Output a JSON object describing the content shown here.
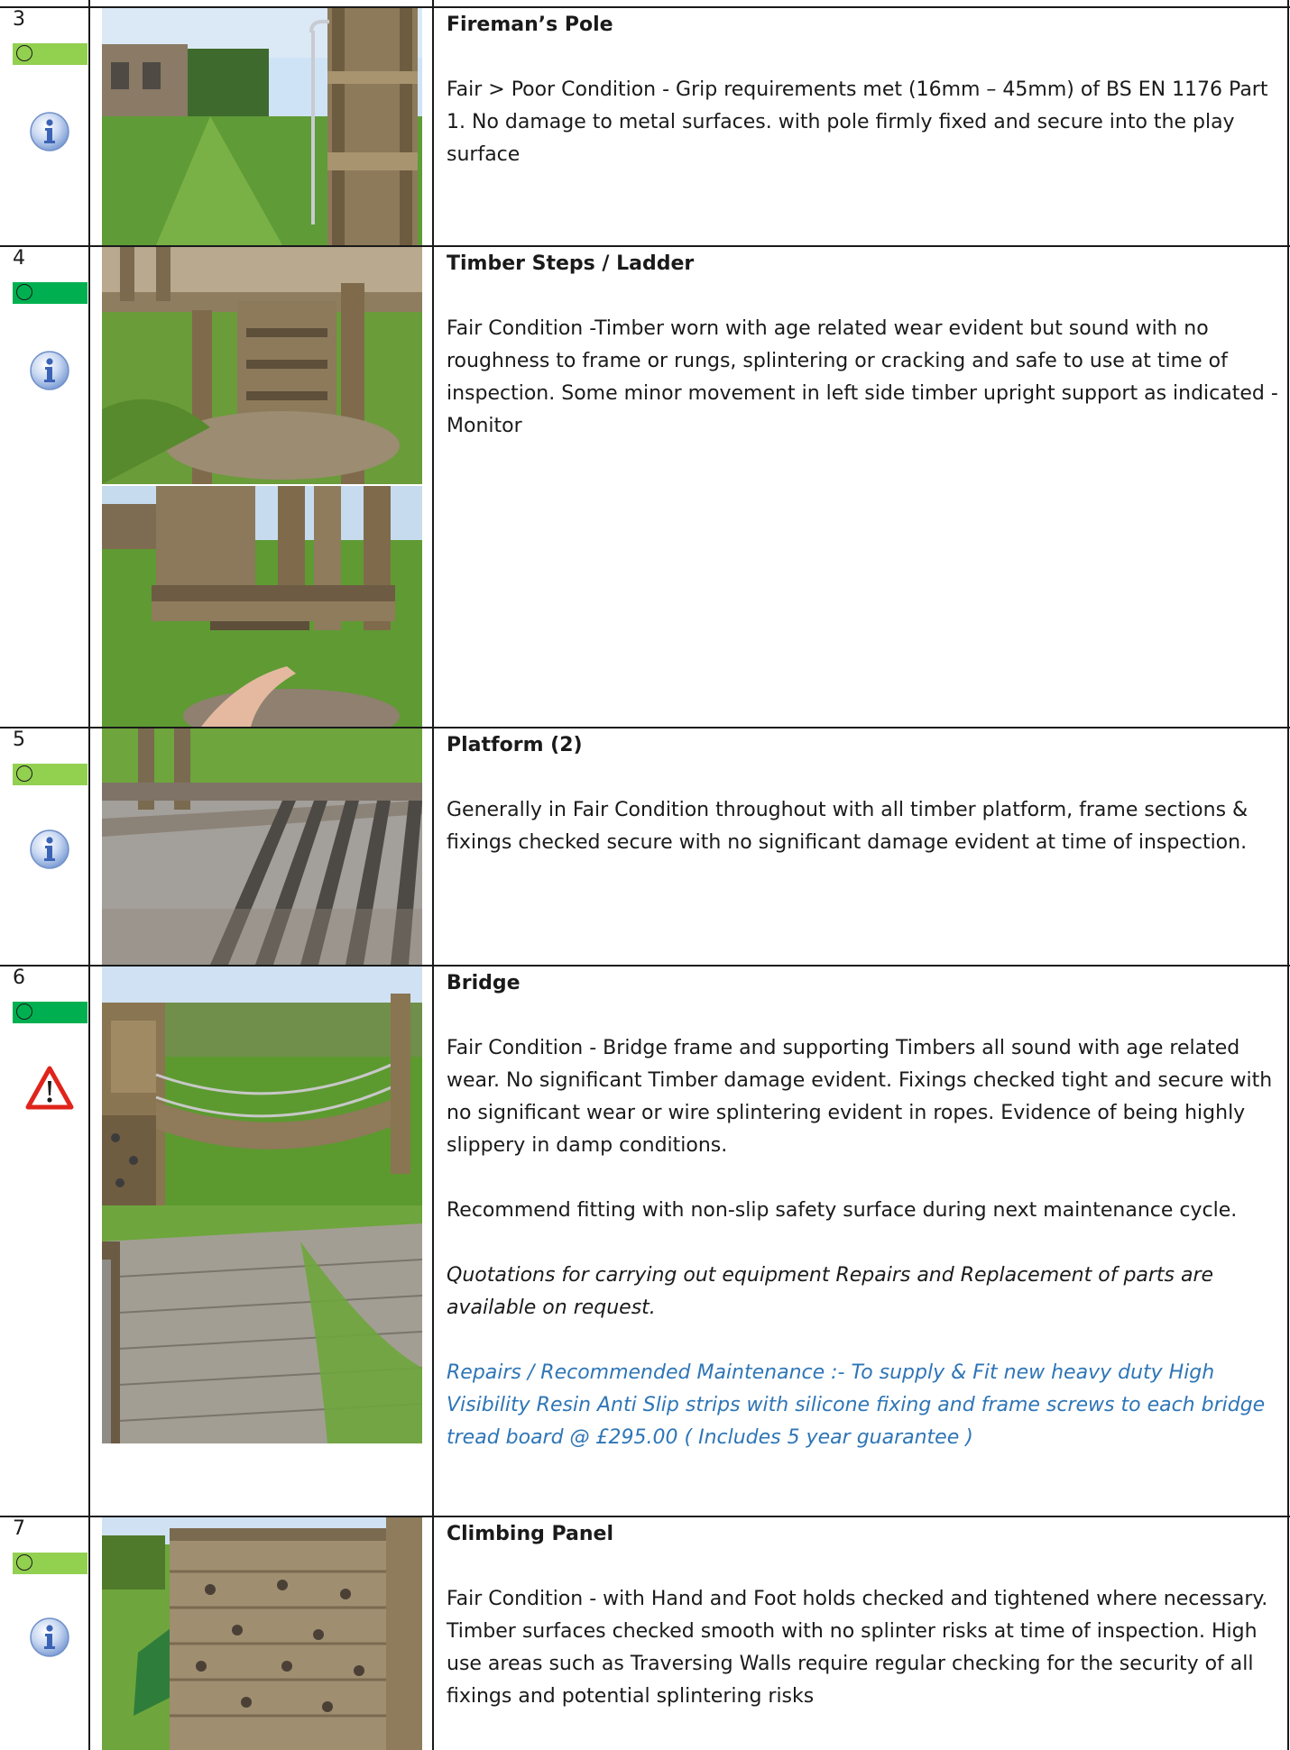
{
  "colors": {
    "status_light_green": "#92d050",
    "status_green": "#00b050",
    "blue_text": "#2e75b6"
  },
  "rows": [
    {
      "number": "3",
      "status_color": "#92d050",
      "icon": "info-icon",
      "title": "Fireman’s Pole",
      "paragraphs": [
        "Fair > Poor Condition - Grip requirements met (16mm – 45mm) of BS EN 1176 Part 1. No damage to metal surfaces. with pole firmly fixed and secure into the play surface"
      ],
      "photos": [
        "Fireman's pole beside timber tower on grass"
      ]
    },
    {
      "number": "4",
      "status_color": "#00b050",
      "icon": "info-icon",
      "title": "Timber Steps / Ladder",
      "paragraphs": [
        "Fair Condition -Timber worn with age related wear evident but sound with no roughness to frame or rungs,  splintering or cracking and safe to use at time of inspection. Some minor movement in left side  timber upright support as indicated - Monitor"
      ],
      "photos": [
        "Timber ladder steps below platform",
        "Hand pointing at timber upright support"
      ]
    },
    {
      "number": "5",
      "status_color": "#92d050",
      "icon": "info-icon",
      "title": "Platform (2)",
      "paragraphs": [
        "Generally in Fair Condition throughout with all timber platform, frame sections & fixings checked secure with no significant damage evident at time of inspection."
      ],
      "photos": [
        "Timber deck platform with shadows"
      ]
    },
    {
      "number": "6",
      "status_color": "#00b050",
      "icon": "warning-icon",
      "title": "Bridge",
      "paragraphs": [
        "Fair Condition - Bridge frame and supporting Timbers all sound with age related wear. No significant Timber damage evident. Fixings checked tight and secure with no significant wear or wire splintering evident in ropes. Evidence of being highly slippery in damp conditions.",
        "Recommend fitting with non-slip safety surface during next maintenance cycle."
      ],
      "italic_note": "Quotations for carrying out equipment Repairs and Replacement of parts are available on request.",
      "repair_note": "Repairs /  Recommended Maintenance :- To supply & Fit new heavy duty High Visibility Resin Anti Slip strips with silicone fixing and frame screws to each bridge tread board @ £295.00 ( Includes 5 year guarantee )",
      "photos": [
        "Rope bridge between timber towers",
        "Timber bridge tread boards with rope"
      ]
    },
    {
      "number": "7",
      "status_color": "#92d050",
      "icon": "info-icon",
      "title": "Climbing Panel",
      "paragraphs": [
        "Fair Condition - with Hand and Foot holds checked and tightened where necessary.  Timber surfaces checked smooth with no splinter risks at time of inspection. High use areas such as Traversing Walls require regular checking for the security of all fixings and potential splintering risks"
      ],
      "photos": [
        "Timber climbing panel with holds"
      ]
    }
  ]
}
